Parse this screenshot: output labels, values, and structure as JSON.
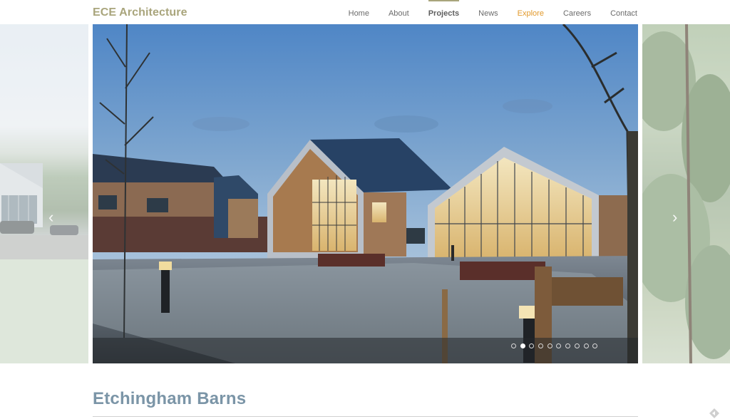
{
  "brand": {
    "logo_text": "ECE Architecture",
    "accent": "#a9a57c"
  },
  "nav": {
    "items": [
      {
        "label": "Home",
        "state": "normal"
      },
      {
        "label": "About",
        "state": "normal"
      },
      {
        "label": "Projects",
        "state": "active"
      },
      {
        "label": "News",
        "state": "normal"
      },
      {
        "label": "Explore",
        "state": "highlight"
      },
      {
        "label": "Careers",
        "state": "normal"
      },
      {
        "label": "Contact",
        "state": "normal"
      }
    ],
    "highlight_color": "#e2992b"
  },
  "carousel": {
    "slide_count": 10,
    "active_slide": 2,
    "prev_icon": "chevron-left-icon",
    "next_icon": "chevron-right-icon"
  },
  "project": {
    "title": "Etchingham Barns",
    "title_color": "#7b95a7"
  },
  "footer": {
    "corner_icon": "diamond-arrow-icon"
  }
}
